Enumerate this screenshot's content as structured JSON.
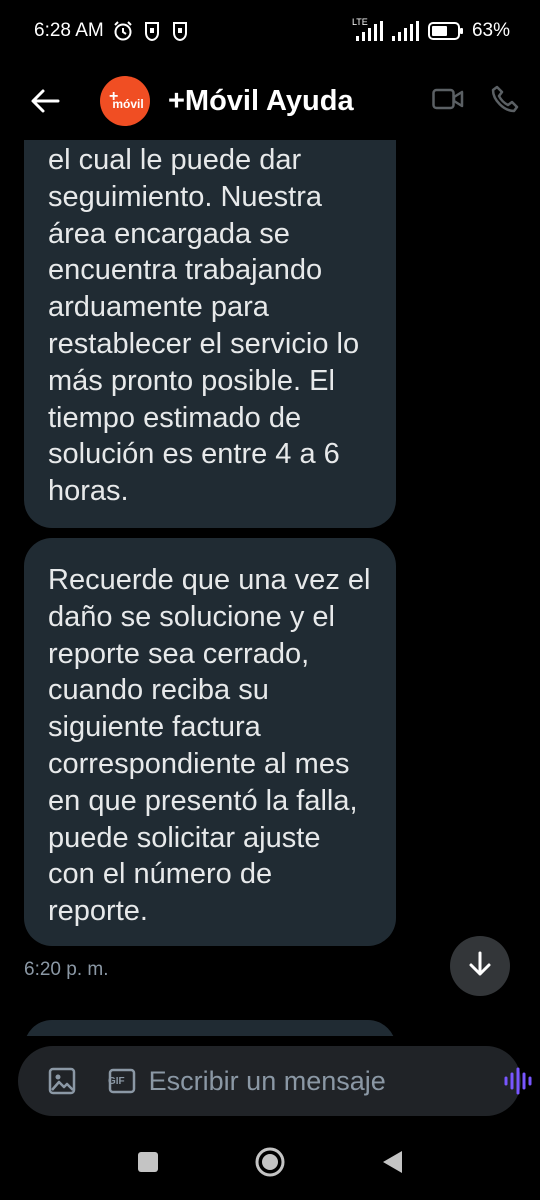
{
  "status_bar": {
    "time": "6:28 AM",
    "network": "LTE",
    "battery": "63%",
    "icons": [
      "alarm-icon",
      "notification-icon",
      "notification-icon",
      "signal-icon",
      "signal-icon",
      "battery-icon"
    ]
  },
  "header": {
    "avatar_plus": "+",
    "avatar_brand": "móvil",
    "title": "+Móvil Ayuda",
    "brand_color": "#f04e23",
    "icons": [
      "back-arrow-icon",
      "video-call-icon",
      "phone-icon"
    ]
  },
  "messages": [
    {
      "text": "el cual le puede dar seguimiento. Nuestra área encargada se encuentra trabajando arduamente para restablecer el servicio lo más pronto posible. El tiempo estimado de solución es entre 4 a 6 horas."
    },
    {
      "text": "Recuerde que una vez el daño se solucione y el reporte sea cerrado, cuando reciba su siguiente factura correspondiente al mes en que presentó la falla, puede solicitar ajuste con el número de reporte."
    }
  ],
  "timestamp": "6:20 p. m.",
  "composer": {
    "placeholder": "Escribir un mensaje",
    "gif_label": "GIF",
    "icons": [
      "image-icon",
      "gif-icon",
      "voice-icon"
    ],
    "accent_color": "#7856ff"
  },
  "nav_icons": [
    "recents-icon",
    "home-icon",
    "back-icon"
  ]
}
